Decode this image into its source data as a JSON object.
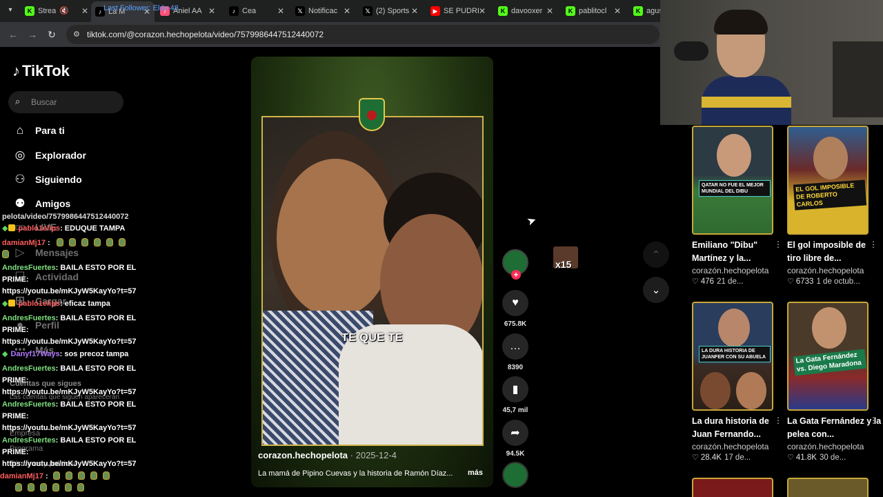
{
  "browser": {
    "tabs": [
      {
        "title": "Strea",
        "icon": "kick-icon",
        "color": "#53fc18",
        "muted": true
      },
      {
        "title": "La M",
        "icon": "tiktok-icon",
        "color": "#ffffff",
        "overlay": "Last Follower: Elde 48"
      },
      {
        "title": "Aniel AA",
        "icon": "tiktok-icon",
        "color": "#ff4f7a"
      },
      {
        "title": "Cea",
        "icon": "tiktok-icon",
        "color": "#ffffff"
      },
      {
        "title": "Notificac",
        "icon": "x-icon",
        "color": "#ffffff"
      },
      {
        "title": "(2) Sports",
        "icon": "x-icon",
        "color": "#ffffff"
      },
      {
        "title": "SE PUDRI",
        "icon": "youtube-icon",
        "color": "#ff0000"
      },
      {
        "title": "davooxer",
        "icon": "kick-icon",
        "color": "#53fc18"
      },
      {
        "title": "pablitocl",
        "icon": "kick-icon",
        "color": "#53fc18"
      },
      {
        "title": "agus",
        "icon": "kick-icon",
        "color": "#53fc18"
      }
    ],
    "url": "tiktok.com/@corazon.hechopelota/video/7579986447512440072"
  },
  "sidebar": {
    "logo": "TikTok",
    "search_placeholder": "Buscar",
    "nav": [
      {
        "label": "Para ti",
        "icon": "home-icon"
      },
      {
        "label": "Explorador",
        "icon": "compass-icon"
      },
      {
        "label": "Siguiendo",
        "icon": "following-icon"
      },
      {
        "label": "Amigos",
        "icon": "friends-icon"
      },
      {
        "label": "LIVE",
        "icon": "live-icon"
      },
      {
        "label": "Mensajes",
        "icon": "messages-icon"
      },
      {
        "label": "Actividad",
        "icon": "activity-icon"
      },
      {
        "label": "Cargar",
        "icon": "upload-icon"
      },
      {
        "label": "Perfil",
        "icon": "profile-icon"
      },
      {
        "label": "Más",
        "icon": "more-icon"
      }
    ],
    "following_title": "Cuentas que sigues",
    "following_note": "Las cuentas que siguen aparecerán",
    "footer": [
      "Empresa",
      "Programa",
      "Términos y políticas"
    ]
  },
  "chat": {
    "url_fragment": "pelota/video/7579986447512440072",
    "messages": [
      {
        "user": "pablo1elips",
        "text": ": EDUQUE TAMPA",
        "user_color": "red",
        "badges": true
      },
      {
        "user": "damianMj17",
        "text": " :",
        "user_color": "red",
        "emotes": 7
      },
      {
        "user": "AndresFuertes",
        "text": ": BAILA ESTO POR EL PRIME: https://youtu.be/mKJyW5KayYo?t=57",
        "user_color": "green"
      },
      {
        "user": "pablo1elips",
        "text": ": eficaz tampa",
        "user_color": "red",
        "badges": true
      },
      {
        "user": "AndresFuertes",
        "text": ": BAILA ESTO POR EL PRIME: https://youtu.be/mKJyW5KayYo?t=57",
        "user_color": "green"
      },
      {
        "user": "Danyf17Ways",
        "text": ": sos precoz tampa",
        "user_color": "purple",
        "badges": true
      },
      {
        "user": "AndresFuertes",
        "text": ": BAILA ESTO POR EL PRIME: https://youtu.be/mKJyW5KayYo?t=57",
        "user_color": "green"
      },
      {
        "user": "AndresFuertes",
        "text": ": BAILA ESTO POR EL PRIME: https://youtu.be/mKJyW5KayYo?t=57",
        "user_color": "green"
      },
      {
        "user": "AndresFuertes",
        "text": ": BAILA ESTO POR EL PRIME: https://youtu.be/mKJyW5KayYo?t=57",
        "user_color": "green"
      },
      {
        "user": "damianMj17",
        "text": " :",
        "user_color": "red",
        "emotes": 8
      }
    ]
  },
  "video": {
    "caption_word": "TE QUE TE",
    "author": "corazon.hechopelota",
    "date": "2025-12-4",
    "description": "La mamá de Pipino Cuevas y la historia de Ramón Díaz...",
    "more": "más"
  },
  "actions": {
    "likes": "675.8K",
    "comments": "8390",
    "saves": "45,7 mil",
    "shares": "94.5K"
  },
  "overlay_emote_count": "x15",
  "recommendations": [
    {
      "title": "Emiliano \"Dibu\" Martínez y la...",
      "author": "corazón.hechopelota",
      "likes": "476",
      "date": "21 de...",
      "thumb_caption": "QATAR NO FUE EL MEJOR MUNDIAL DEL DIBU",
      "thumb_color": "#3a7a3a"
    },
    {
      "title": "El gol imposible de tiro libre de...",
      "author": "corazón.hechopelota",
      "likes": "6733",
      "date": "1 de octub...",
      "thumb_caption": "EL GOL IMPOSIBLE DE ROBERTO CARLOS",
      "thumb_color": "#2f5e8f"
    },
    {
      "title": "La dura historia de Juan Fernando...",
      "author": "corazón.hechopelota",
      "likes": "28.4K",
      "date": "17 de...",
      "thumb_caption": "LA DURA HISTORIA DE JUANFER CON SU ABUELA",
      "thumb_color": "#2a3d5c"
    },
    {
      "title": "La Gata Fernández y la pelea con...",
      "author": "corazón.hechopelota",
      "likes": "41.8K",
      "date": "30 de...",
      "thumb_caption": "La Gata Fernández vs. Diego Maradona",
      "thumb_color": "#4a3a2a"
    }
  ]
}
